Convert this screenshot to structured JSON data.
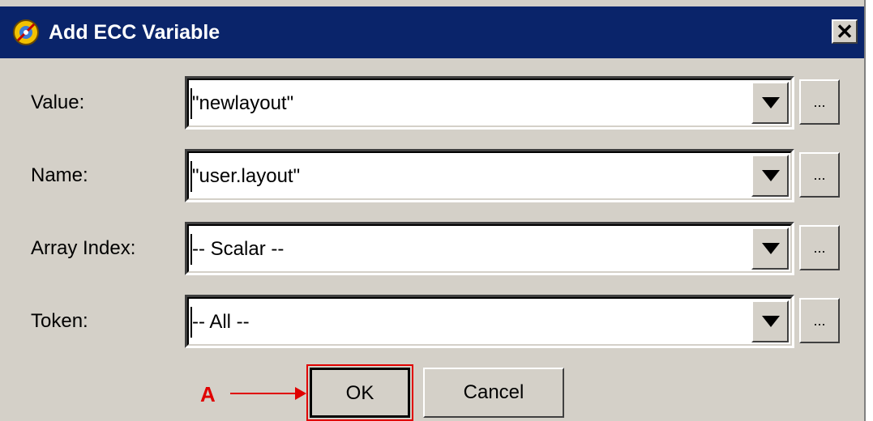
{
  "window": {
    "title": "Add ECC Variable",
    "close_glyph": "✕"
  },
  "fields": [
    {
      "label": "Value:",
      "value": "\"newlayout\""
    },
    {
      "label": "Name:",
      "value": "\"user.layout\""
    },
    {
      "label": "Array Index:",
      "value": "-- Scalar --"
    },
    {
      "label": "Token:",
      "value": "-- All --"
    }
  ],
  "dots_label": "...",
  "buttons": {
    "ok": "OK",
    "cancel": "Cancel"
  },
  "annotation": {
    "letter": "A",
    "color": "#e00000"
  },
  "colors": {
    "titlebar": "#0a246a",
    "face": "#d4d0c8",
    "highlight": "#e00000"
  },
  "icons": {
    "app": "ecc-app-icon",
    "dropdown": "triangle-down-icon",
    "close": "close-icon"
  }
}
